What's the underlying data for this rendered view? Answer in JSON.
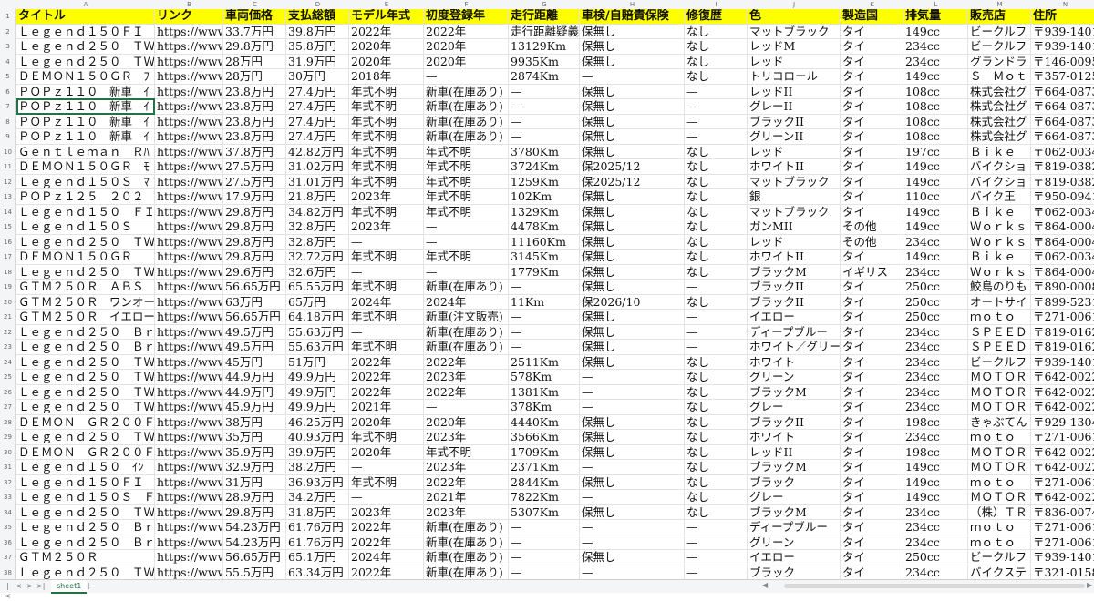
{
  "columns": [
    "A",
    "B",
    "C",
    "D",
    "E",
    "F",
    "G",
    "H",
    "I",
    "J",
    "K",
    "L",
    "M",
    "N"
  ],
  "header": [
    "タイトル",
    "リンク",
    "車両価格",
    "支払総額",
    "モデル年式",
    "初度登録年",
    "走行距離",
    "車検/自賠責保険",
    "修復歴",
    "色",
    "製造国",
    "排気量",
    "販売店",
    "住所"
  ],
  "rows": [
    [
      "Ｌｅｇｅｎｄ１５０ＦＩ",
      "https://www",
      "33.7万円",
      "39.8万円",
      "2022年",
      "2022年",
      "走行距離疑義",
      "保無し",
      "なし",
      "マットブラック",
      "タイ",
      "149cc",
      "ビークルフ",
      "〒939-1401"
    ],
    [
      "Ｌｅｇｅｎｄ２５０　ＴＷ",
      "https://www",
      "29.8万円",
      "35.8万円",
      "2020年",
      "2020年",
      "13129Km",
      "保無し",
      "なし",
      "レッドM",
      "タイ",
      "234cc",
      "ビークルフ",
      "〒939-1401"
    ],
    [
      "Ｌｅｇｅｎｄ２５０　ＴＷ",
      "https://www",
      "28万円",
      "31.9万円",
      "2020年",
      "2020年",
      "9935Km",
      "保無し",
      "なし",
      "レッド",
      "タイ",
      "234cc",
      "グランドラ",
      "〒146-0095"
    ],
    [
      "ＤＥＭＯＮ１５０ＧＲ　ﾌ",
      "https://www",
      "28万円",
      "30万円",
      "2018年",
      "—",
      "2874Km",
      "—",
      "なし",
      "トリコロール",
      "タイ",
      "149cc",
      "Ｓ　Ｍｏｔ",
      "〒357-0125"
    ],
    [
      "ＰＯＰｚ１１０　新車　ｲ",
      "https://www",
      "23.8万円",
      "27.4万円",
      "年式不明",
      "新車(在庫あり)",
      "—",
      "保無し",
      "—",
      "レッドII",
      "タイ",
      "108cc",
      "株式会社グ",
      "〒664-0873"
    ],
    [
      "ＰＯＰｚ１１０　新車　ｲ",
      "https://www",
      "23.8万円",
      "27.4万円",
      "年式不明",
      "新車(在庫あり)",
      "—",
      "保無し",
      "—",
      "グレーII",
      "タイ",
      "108cc",
      "株式会社グ",
      "〒664-0873"
    ],
    [
      "ＰＯＰｚ１１０　新車　ｲ",
      "https://www",
      "23.8万円",
      "27.4万円",
      "年式不明",
      "新車(在庫あり)",
      "—",
      "保無し",
      "—",
      "ブラックII",
      "タイ",
      "108cc",
      "株式会社グ",
      "〒664-0873"
    ],
    [
      "ＰＯＰｚ１１０　新車　ｲ",
      "https://www",
      "23.8万円",
      "27.4万円",
      "年式不明",
      "新車(在庫あり)",
      "—",
      "保無し",
      "—",
      "グリーンII",
      "タイ",
      "108cc",
      "株式会社グ",
      "〒664-0873"
    ],
    [
      "Ｇｅｎｔｌｅｍａｎ　Ｒﾊ",
      "https://www",
      "37.8万円",
      "42.82万円",
      "年式不明",
      "年式不明",
      "3780Km",
      "保無し",
      "なし",
      "レッド",
      "タイ",
      "197cc",
      "Ｂｉｋｅ",
      "〒062-0034"
    ],
    [
      "ＤＥＭＯＮ１５０ＧＲ　ﾓ",
      "https://www",
      "27.5万円",
      "31.02万円",
      "年式不明",
      "年式不明",
      "3724Km",
      "保2025/12",
      "なし",
      "ホワイトII",
      "タイ",
      "149cc",
      "バイクショ",
      "〒819-0382"
    ],
    [
      "Ｌｅｇｅｎｄ１５０Ｓ　ﾏ",
      "https://www",
      "27.5万円",
      "31.01万円",
      "年式不明",
      "年式不明",
      "1259Km",
      "保2025/12",
      "なし",
      "マットブラック",
      "タイ",
      "149cc",
      "バイクショ",
      "〒819-0382"
    ],
    [
      "ＰＯＰｚ１２５　２０２",
      "https://www",
      "17.9万円",
      "21.8万円",
      "2023年",
      "年式不明",
      "102Km",
      "保無し",
      "なし",
      "銀",
      "タイ",
      "110cc",
      "バイク王",
      "〒950-0941"
    ],
    [
      "Ｌｅｇｅｎｄ１５０　ＦＩ",
      "https://www",
      "29.8万円",
      "34.82万円",
      "年式不明",
      "年式不明",
      "1329Km",
      "保無し",
      "なし",
      "マットブラック",
      "タイ",
      "149cc",
      "Ｂｉｋｅ",
      "〒062-0034"
    ],
    [
      "Ｌｅｇｅｎｄ１５０Ｓ",
      "https://www",
      "29.8万円",
      "32.8万円",
      "2023年",
      "—",
      "4478Km",
      "保無し",
      "なし",
      "ガンMII",
      "その他",
      "149cc",
      "Ｗｏｒｋｓ",
      "〒864-0004"
    ],
    [
      "Ｌｅｇｅｎｄ２５０　ＴＷ",
      "https://www",
      "29.8万円",
      "32.8万円",
      "—",
      "—",
      "11160Km",
      "保無し",
      "なし",
      "レッド",
      "その他",
      "234cc",
      "Ｗｏｒｋｓ",
      "〒864-0004"
    ],
    [
      "ＤＥＭＯＮ１５０ＧＲ",
      "https://www",
      "29.8万円",
      "32.72万円",
      "年式不明",
      "年式不明",
      "3145Km",
      "保無し",
      "なし",
      "ホワイトII",
      "タイ",
      "149cc",
      "Ｂｉｋｅ",
      "〒062-0034"
    ],
    [
      "Ｌｅｇｅｎｄ２５０　ＴＷ",
      "https://www",
      "29.6万円",
      "32.6万円",
      "—",
      "—",
      "1779Km",
      "保無し",
      "なし",
      "ブラックM",
      "イギリス",
      "234cc",
      "Ｗｏｒｋｓ",
      "〒864-0004"
    ],
    [
      "ＧＴＭ２５０Ｒ　ＡＢＳ",
      "https://www",
      "56.65万円",
      "65.55万円",
      "年式不明",
      "新車(在庫あり)",
      "—",
      "保無し",
      "—",
      "ブラックII",
      "タイ",
      "250cc",
      "鮫島のりも",
      "〒890-0008"
    ],
    [
      "ＧＴＭ２５０Ｒ　ワンオー",
      "https://www",
      "63万円",
      "65万円",
      "2024年",
      "2024年",
      "11Km",
      "保2026/10",
      "なし",
      "ブラックII",
      "タイ",
      "250cc",
      "オートサイ",
      "〒899-5231"
    ],
    [
      "ＧＴＭ２５０Ｒ　イエロー",
      "https://www",
      "56.65万円",
      "64.18万円",
      "年式不明",
      "新車(注文販売)",
      "—",
      "保無し",
      "—",
      "イエロー",
      "タイ",
      "250cc",
      "ｍｏｔｏ",
      "〒271-0061"
    ],
    [
      "Ｌｅｇｅｎｄ２５０　Ｂｒ",
      "https://www",
      "49.5万円",
      "55.63万円",
      "—",
      "新車(在庫あり)",
      "—",
      "保無し",
      "—",
      "ディープブルー",
      "タイ",
      "234cc",
      "ＳＰＥＥＤ",
      "〒819-0162"
    ],
    [
      "Ｌｅｇｅｎｄ２５０　Ｂｒ",
      "https://www",
      "49.5万円",
      "55.63万円",
      "年式不明",
      "新車(在庫あり)",
      "—",
      "保無し",
      "—",
      "ホワイト／グリーン",
      "タイ",
      "234cc",
      "ＳＰＥＥＤ",
      "〒819-0162"
    ],
    [
      "Ｌｅｇｅｎｄ２５０　ＴＷ",
      "https://www",
      "45万円",
      "51万円",
      "2022年",
      "2022年",
      "2511Km",
      "保無し",
      "なし",
      "ホワイト",
      "タイ",
      "234cc",
      "ビークルフ",
      "〒939-1401"
    ],
    [
      "Ｌｅｇｅｎｄ２５０　ＴＷ",
      "https://www",
      "44.9万円",
      "49.9万円",
      "2022年",
      "2023年",
      "578Km",
      "—",
      "なし",
      "グリーン",
      "タイ",
      "234cc",
      "ＭＯＴＯＲ",
      "〒642-0022"
    ],
    [
      "Ｌｅｇｅｎｄ２５０　ＴＷ",
      "https://www",
      "44.9万円",
      "49.9万円",
      "2022年",
      "2022年",
      "1381Km",
      "—",
      "なし",
      "ブラックM",
      "タイ",
      "234cc",
      "ＭＯＴＯＲ",
      "〒642-0022"
    ],
    [
      "Ｌｅｇｅｎｄ２５０　ＴＷ",
      "https://www",
      "45.9万円",
      "49.9万円",
      "2021年",
      "—",
      "378Km",
      "—",
      "なし",
      "グレー",
      "タイ",
      "234cc",
      "ＭＯＴＯＲ",
      "〒642-0022"
    ],
    [
      "ＤＥＭＯＮ　ＧＲ２００Ｆ",
      "https://www",
      "38万円",
      "46.25万円",
      "2020年",
      "2020年",
      "4440Km",
      "保無し",
      "なし",
      "ブラックII",
      "タイ",
      "198cc",
      "きゃぶてん",
      "〒929-1304"
    ],
    [
      "Ｌｅｇｅｎｄ２５０　ＴＷ",
      "https://www",
      "35万円",
      "40.93万円",
      "年式不明",
      "2023年",
      "3566Km",
      "保無し",
      "なし",
      "ホワイト",
      "タイ",
      "234cc",
      "ｍｏｔｏ",
      "〒271-0061"
    ],
    [
      "ＤＥＭＯＮ　ＧＲ２００Ｆ",
      "https://www",
      "35.9万円",
      "39.9万円",
      "2020年",
      "年式不明",
      "1709Km",
      "保無し",
      "なし",
      "レッドII",
      "タイ",
      "198cc",
      "ＭＯＴＯＲ",
      "〒642-0022"
    ],
    [
      "Ｌｅｇｅｎｄ１５０　ｲﾝ",
      "https://www",
      "32.9万円",
      "38.2万円",
      "—",
      "2023年",
      "2371Km",
      "—",
      "なし",
      "ブラックM",
      "タイ",
      "149cc",
      "ＭＯＴＯＲ",
      "〒642-0022"
    ],
    [
      "Ｌｅｇｅｎｄ１５０ＦＩ　ﾌ",
      "https://www",
      "31万円",
      "36.93万円",
      "年式不明",
      "2022年",
      "2844Km",
      "保無し",
      "なし",
      "ブラック",
      "タイ",
      "149cc",
      "ｍｏｔｏ",
      "〒271-0061"
    ],
    [
      "Ｌｅｇｅｎｄ１５０Ｓ　Ｆ",
      "https://www",
      "28.9万円",
      "34.2万円",
      "—",
      "2021年",
      "7822Km",
      "—",
      "なし",
      "グレー",
      "タイ",
      "149cc",
      "ＭＯＴＯＲ",
      "〒642-0022"
    ],
    [
      "Ｌｅｇｅｎｄ２５０　ＴＷ",
      "https://www",
      "29.8万円",
      "31.8万円",
      "2023年",
      "2023年",
      "5307Km",
      "保無し",
      "なし",
      "ブラックM",
      "タイ",
      "234cc",
      "（株）ＴＲ",
      "〒836-0074"
    ],
    [
      "Ｌｅｇｅｎｄ２５０　Ｂｒ",
      "https://www",
      "54.23万円",
      "61.76万円",
      "2022年",
      "新車(在庫あり)",
      "—",
      "—",
      "—",
      "ディープブルー",
      "タイ",
      "234cc",
      "ｍｏｔｏ",
      "〒271-0061"
    ],
    [
      "Ｌｅｇｅｎｄ２５０　Ｂｒ",
      "https://www",
      "54.23万円",
      "61.76万円",
      "2022年",
      "新車(在庫あり)",
      "—",
      "—",
      "—",
      "グリーン",
      "タイ",
      "234cc",
      "ｍｏｔｏ",
      "〒271-0061"
    ],
    [
      "ＧＴＭ２５０Ｒ",
      "https://www",
      "56.65万円",
      "65.1万円",
      "2024年",
      "新車(在庫あり)",
      "—",
      "保無し",
      "—",
      "イエロー",
      "タイ",
      "250cc",
      "ビークルフ",
      "〒939-1401"
    ],
    [
      "Ｌｅｇｅｎｄ２５０　ＴＷ",
      "https://www",
      "55.5万円",
      "63.34万円",
      "2022年",
      "新車(在庫あり)",
      "—",
      "—",
      "—",
      "ブラック",
      "タイ",
      "234cc",
      "バイクステ",
      "〒321-0158"
    ]
  ],
  "sheet_tab": "sheet1",
  "add_tab": "+",
  "nav": [
    "|<",
    "<",
    ">",
    ">|"
  ],
  "colors": {
    "header_fill": "#ffff00",
    "selection": "#217346",
    "grid": "#e3e3e3"
  }
}
